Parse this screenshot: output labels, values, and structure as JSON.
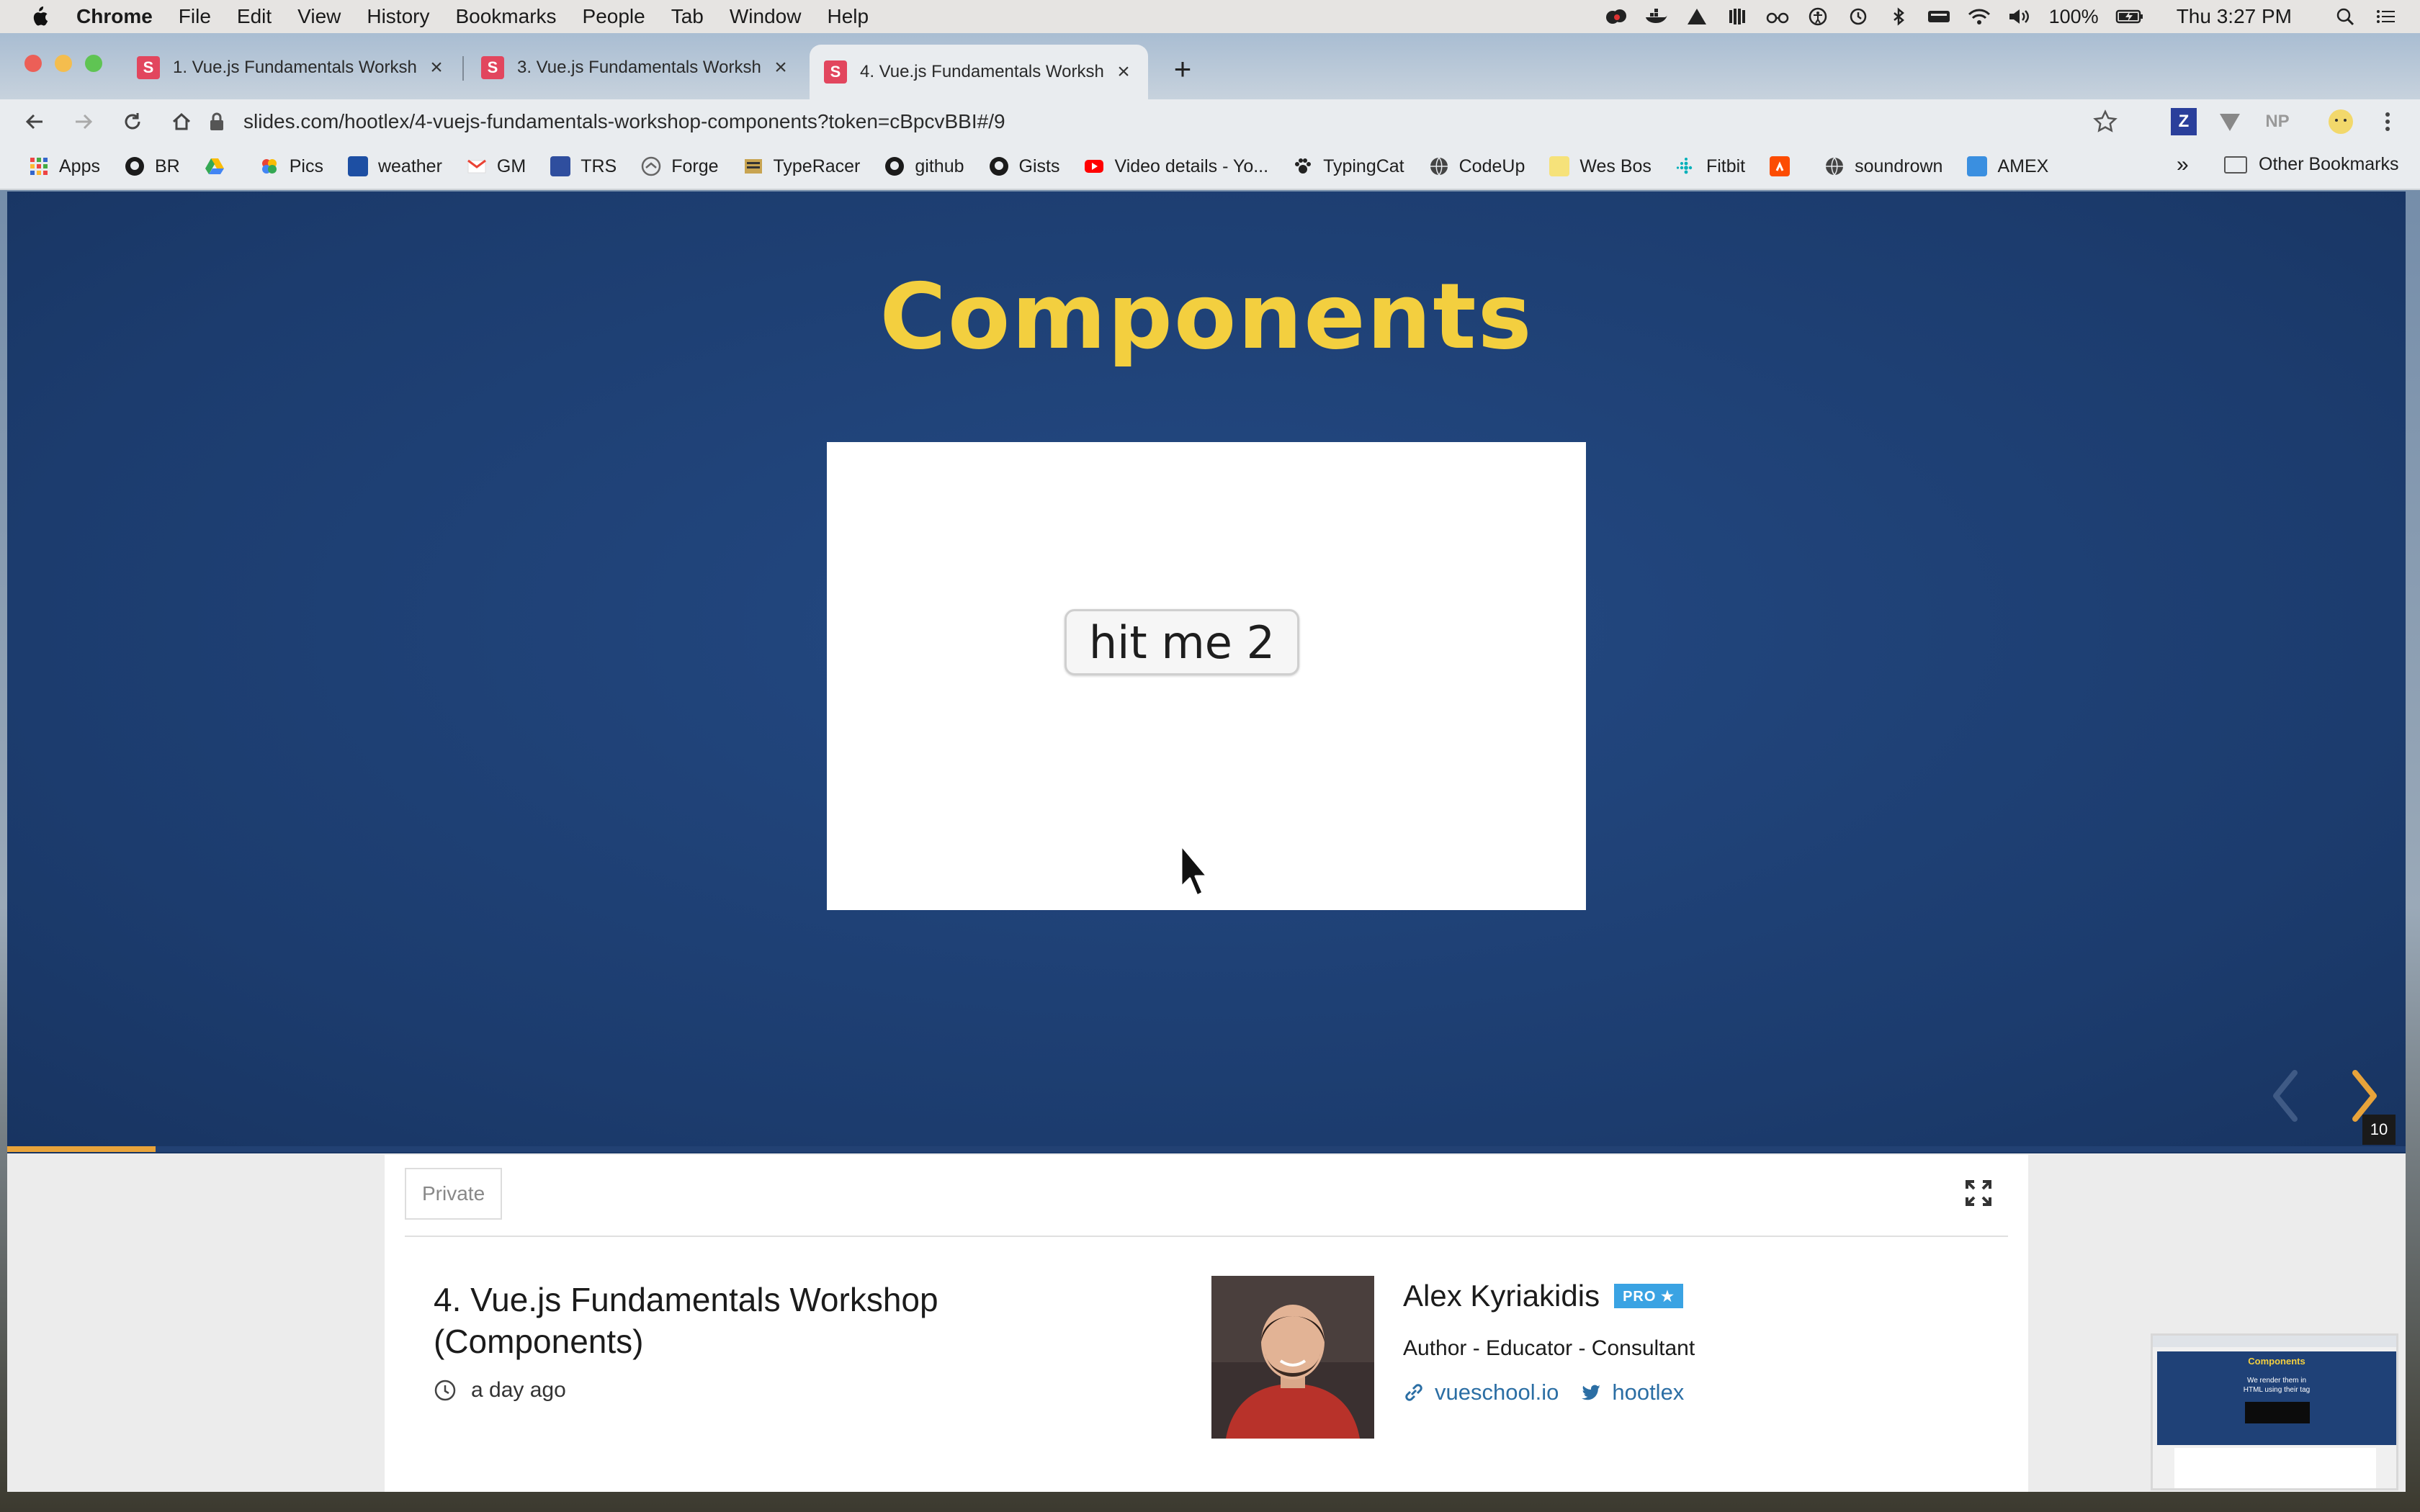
{
  "menubar": {
    "app": "Chrome",
    "items": [
      "File",
      "Edit",
      "View",
      "History",
      "Bookmarks",
      "People",
      "Tab",
      "Window",
      "Help"
    ],
    "battery": "100%",
    "clock": "Thu 3:27 PM"
  },
  "tabs": [
    {
      "label": "1. Vue.js Fundamentals Worksh",
      "favicon": "S",
      "close": "×"
    },
    {
      "label": "3. Vue.js Fundamentals Worksh",
      "favicon": "S",
      "close": "×"
    },
    {
      "label": "4. Vue.js Fundamentals Worksh",
      "favicon": "S",
      "close": "×"
    }
  ],
  "new_tab": "+",
  "address_bar": {
    "url": "slides.com/hootlex/4-vuejs-fundamentals-workshop-components?token=cBpcvBBI#/9"
  },
  "extensions": [
    "Z",
    "NP"
  ],
  "bookmarks": {
    "items": [
      "Apps",
      "BR",
      "",
      "Pics",
      "weather",
      "GM",
      "TRS",
      "Forge",
      "TypeRacer",
      "github",
      "Gists",
      "Video details - Yo...",
      "TypingCat",
      "CodeUp",
      "Wes Bos",
      "Fitbit",
      "",
      "soundrown",
      "AMEX"
    ],
    "more": "»",
    "other": "Other Bookmarks"
  },
  "slide": {
    "title": "Components",
    "demo_button": "hit me 2",
    "slide_number": "10",
    "progress_fraction": 0.062,
    "title_color": "#f3cf3f",
    "background_color": "#1f4177"
  },
  "deck": {
    "privacy": "Private",
    "title_line1": "4. Vue.js Fundamentals Workshop",
    "title_line2": "(Components)",
    "time": "a day ago"
  },
  "author": {
    "name": "Alex Kyriakidis",
    "badge": "PRO ★",
    "role": "Author - Educator - Consultant",
    "website": "vueschool.io",
    "twitter": "hootlex"
  },
  "preview": {
    "title": "Components",
    "subtitle_line1": "We render them in",
    "subtitle_line2": "HTML using their tag"
  }
}
